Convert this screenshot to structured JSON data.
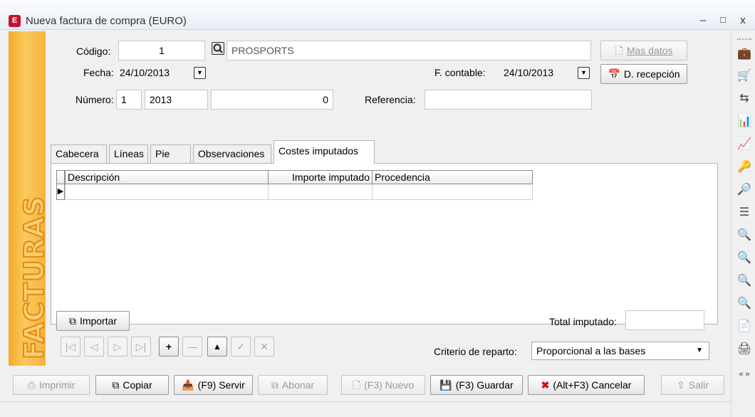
{
  "window": {
    "title": "Nueva factura de compra (EURO)",
    "app_icon_letter": "E",
    "minimize": "–",
    "maximize": "□",
    "close": "x"
  },
  "side_band": {
    "text": "FACTURAS",
    "color": "#f6b33c"
  },
  "header": {
    "codigo_label": "Código:",
    "codigo_value": "1",
    "supplier_name": "PROSPORTS",
    "mas_datos_label": "Mas datos",
    "fecha_label": "Fecha:",
    "fecha_value": "24/10/2013",
    "f_contable_label": "F. contable:",
    "f_contable_value": "24/10/2013",
    "d_recepcion_label": "D. recepción",
    "numero_label": "Número:",
    "numero_serie": "1",
    "numero_year": "2013",
    "numero_value": "0",
    "referencia_label": "Referencia:",
    "referencia_value": ""
  },
  "tabs": [
    {
      "label": "Cabecera"
    },
    {
      "label": "Líneas"
    },
    {
      "label": "Pie"
    },
    {
      "label": "Observaciones"
    },
    {
      "label": "Costes imputados",
      "active": true
    }
  ],
  "grid": {
    "columns": [
      "Descripción",
      "Importe imputado",
      "Procedencia"
    ],
    "row_indicator": "▶"
  },
  "importar_label": "Importar",
  "total_imputado_label": "Total imputado:",
  "total_imputado_value": "",
  "nav_buttons": [
    "|◁",
    "◁",
    "▷",
    "▷|",
    "+",
    "—",
    "▲",
    "✓",
    "✕"
  ],
  "criterio": {
    "label": "Criterio de reparto:",
    "value": "Proporcional a las bases"
  },
  "bottom_buttons": {
    "imprimir": "Imprimir",
    "copiar": "Copiar",
    "servir": "(F9) Servir",
    "abonar": "Abonar",
    "nuevo": "(F3) Nuevo",
    "guardar": "(F3) Guardar",
    "cancelar": "(Alt+F3) Cancelar",
    "salir": "Salir"
  },
  "sidebar_more": "« »"
}
